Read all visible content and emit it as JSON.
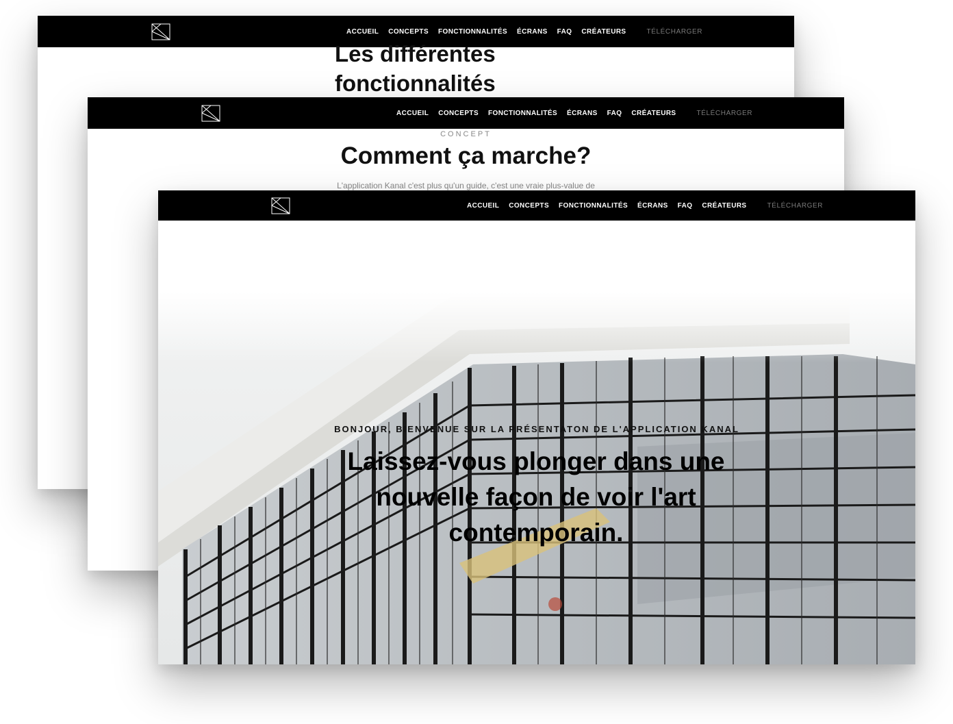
{
  "nav": {
    "items": [
      "ACCUEIL",
      "CONCEPTS",
      "FONCTIONNALITÉS",
      "ÉCRANS",
      "FAQ",
      "CRÉATEURS"
    ],
    "download": "TÉLÉCHARGER"
  },
  "windows": {
    "back": {
      "title": "Les différentes fonctionnalités"
    },
    "middle": {
      "eyebrow": "CONCEPT",
      "title": "Comment ça marche?",
      "text": "L'application Kanal c'est plus qu'un guide, c'est une vraie plus-value de"
    },
    "front": {
      "eyebrow": "BONJOUR, BIENVENUE SUR LA PRÉSENTATON DE L'APPLICATION KANAL",
      "title": "Laissez-vous plonger dans une nouvelle façon de voir l'art contemporain.",
      "hero_image": "glass-facade-building-photo"
    }
  },
  "colors": {
    "navbar": "#000000",
    "page": "#ffffff",
    "muted": "#888888"
  }
}
